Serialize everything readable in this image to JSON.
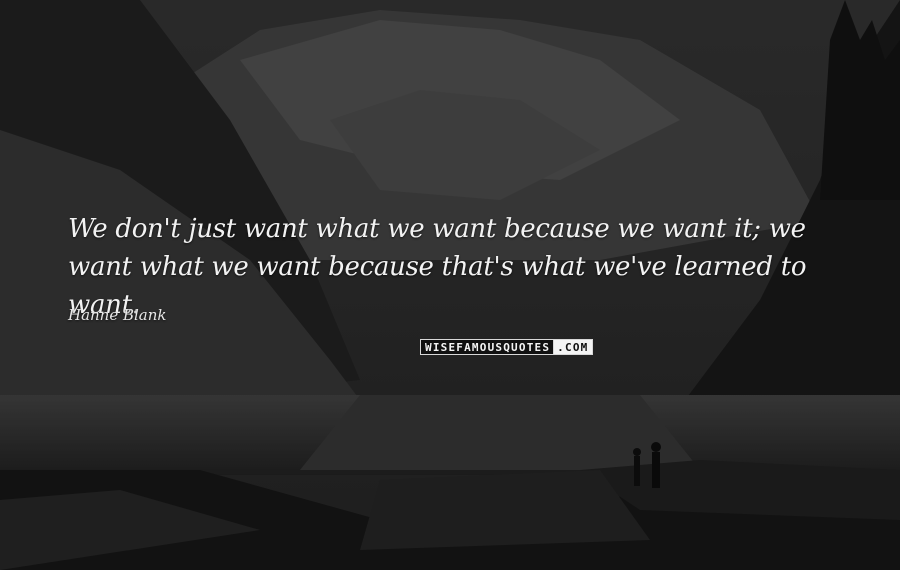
{
  "quote": {
    "text": "We don't just want what we want because we want it; we want what we want because that's what we've learned to want.",
    "author": "Hanne Blank"
  },
  "watermark": {
    "main": "WISEFAMOUSQUOTES",
    "suffix": ".COM"
  },
  "colors": {
    "text": "#f2f2f2",
    "background": "#222222"
  }
}
